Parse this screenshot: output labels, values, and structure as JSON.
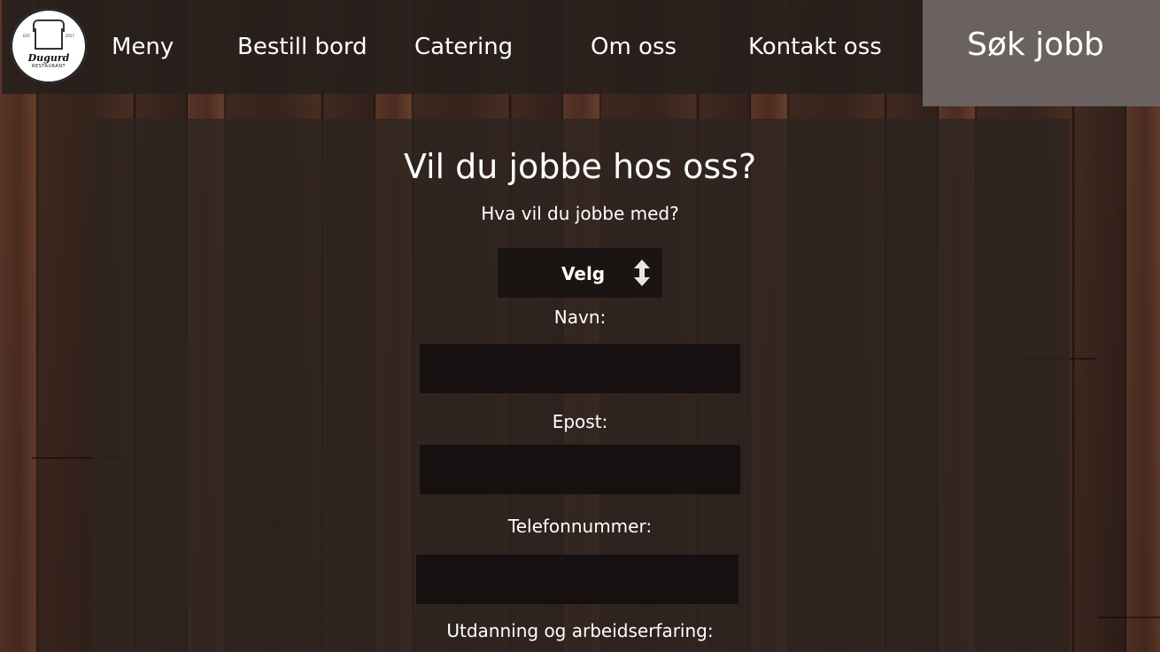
{
  "brand": {
    "name": "Dugurd",
    "sub": "RESTAURANT",
    "est": "EST.",
    "year": "2017"
  },
  "nav": {
    "items": [
      "Meny",
      "Bestill bord",
      "Catering",
      "Om oss",
      "Kontakt oss"
    ],
    "active": "Søk jobb"
  },
  "form": {
    "title": "Vil du jobbe hos oss?",
    "question": "Hva vil du jobbe med?",
    "select_value": "Velg",
    "name_label": "Navn:",
    "email_label": "Epost:",
    "phone_label": "Telefonnummer:",
    "experience_label": "Utdanning og arbeidserfaring:",
    "name_value": "",
    "email_value": "",
    "phone_value": ""
  }
}
